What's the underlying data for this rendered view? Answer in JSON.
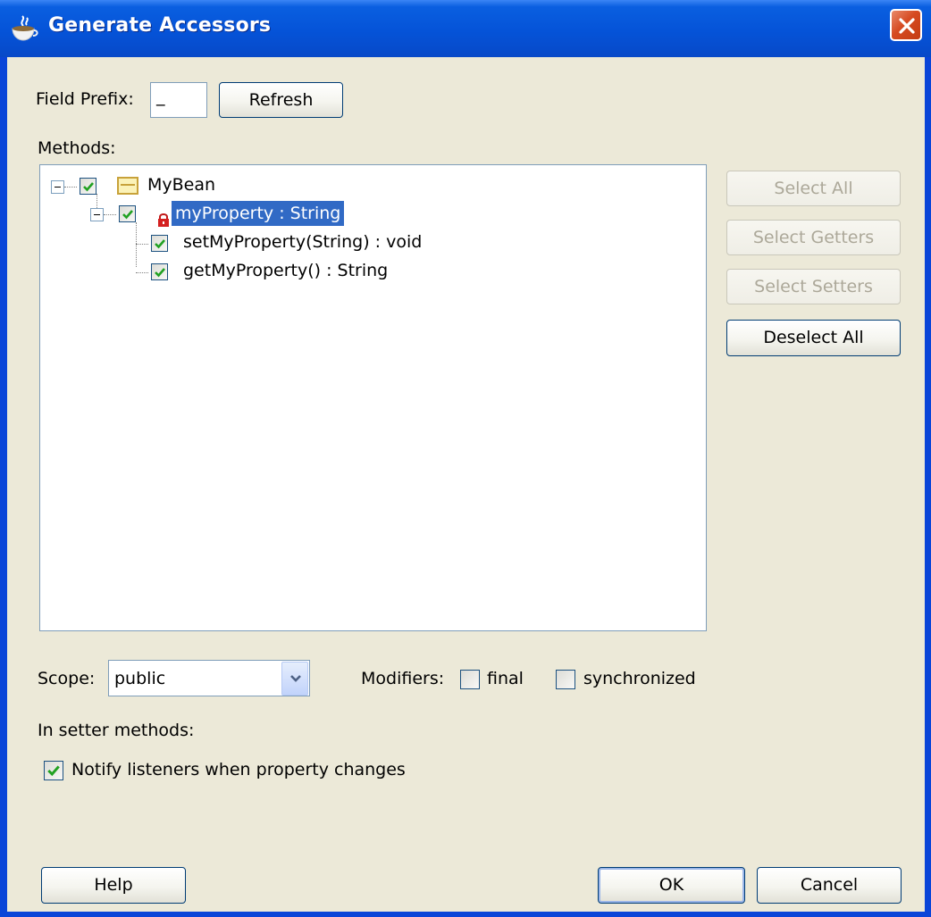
{
  "window": {
    "title": "Generate Accessors",
    "app_icon": "java-cup-icon",
    "close_icon": "close-icon"
  },
  "field_prefix": {
    "label": "Field Prefix:",
    "value": "_",
    "refresh_label": "Refresh"
  },
  "methods": {
    "label": "Methods:",
    "tree": {
      "root": {
        "label": "MyBean",
        "checked": true,
        "icon": "class-icon"
      },
      "property": {
        "label": "myProperty : String",
        "checked": true,
        "selected": true,
        "icon": "private-field-lock-icon"
      },
      "children": [
        {
          "label": "setMyProperty(String) : void",
          "checked": true
        },
        {
          "label": "getMyProperty() : String",
          "checked": true
        }
      ]
    },
    "buttons": {
      "select_all": "Select All",
      "select_getters": "Select Getters",
      "select_setters": "Select Setters",
      "deselect_all": "Deselect All"
    }
  },
  "scope": {
    "label": "Scope:",
    "value": "public"
  },
  "modifiers": {
    "label": "Modifiers:",
    "final_label": "final",
    "final_checked": false,
    "synchronized_label": "synchronized",
    "synchronized_checked": false
  },
  "setter_section": {
    "label": "In setter methods:",
    "notify_label": "Notify listeners when property changes",
    "notify_checked": true
  },
  "footer": {
    "help": "Help",
    "ok": "OK",
    "cancel": "Cancel"
  }
}
